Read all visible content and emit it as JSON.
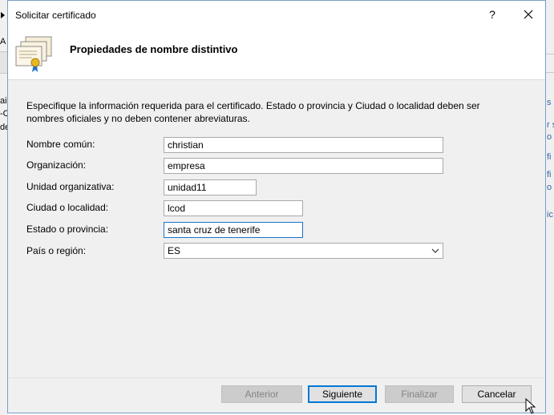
{
  "dialog": {
    "title": "Solicitar certificado",
    "help_glyph": "?",
    "header_title": "Propiedades de nombre distintivo",
    "description": "Especifique la información requerida para el certificado. Estado o provincia y Ciudad o localidad deben ser nombres oficiales y no deben contener abreviaturas."
  },
  "form": {
    "common_name_label": "Nombre común:",
    "common_name_value": "christian",
    "organization_label": "Organización:",
    "organization_value": "empresa",
    "org_unit_label": "Unidad organizativa:",
    "org_unit_value": "unidad11",
    "city_label": "Ciudad o localidad:",
    "city_value": "lcod",
    "state_label": "Estado o provincia:",
    "state_value": "santa cruz de tenerife",
    "country_label": "País o región:",
    "country_value": "ES"
  },
  "buttons": {
    "back": "Anterior",
    "next": "Siguiente",
    "finish": "Finalizar",
    "cancel": "Cancelar"
  },
  "background_fragments": {
    "left": [
      "A",
      "aic",
      "-C",
      "de"
    ],
    "right": [
      "s c",
      "r s",
      "o",
      "fi",
      "fi",
      "o i",
      "ic"
    ]
  },
  "colors": {
    "accent": "#0078d7",
    "dialog_bg": "#f0f0f0",
    "disabled_text": "#838383"
  }
}
